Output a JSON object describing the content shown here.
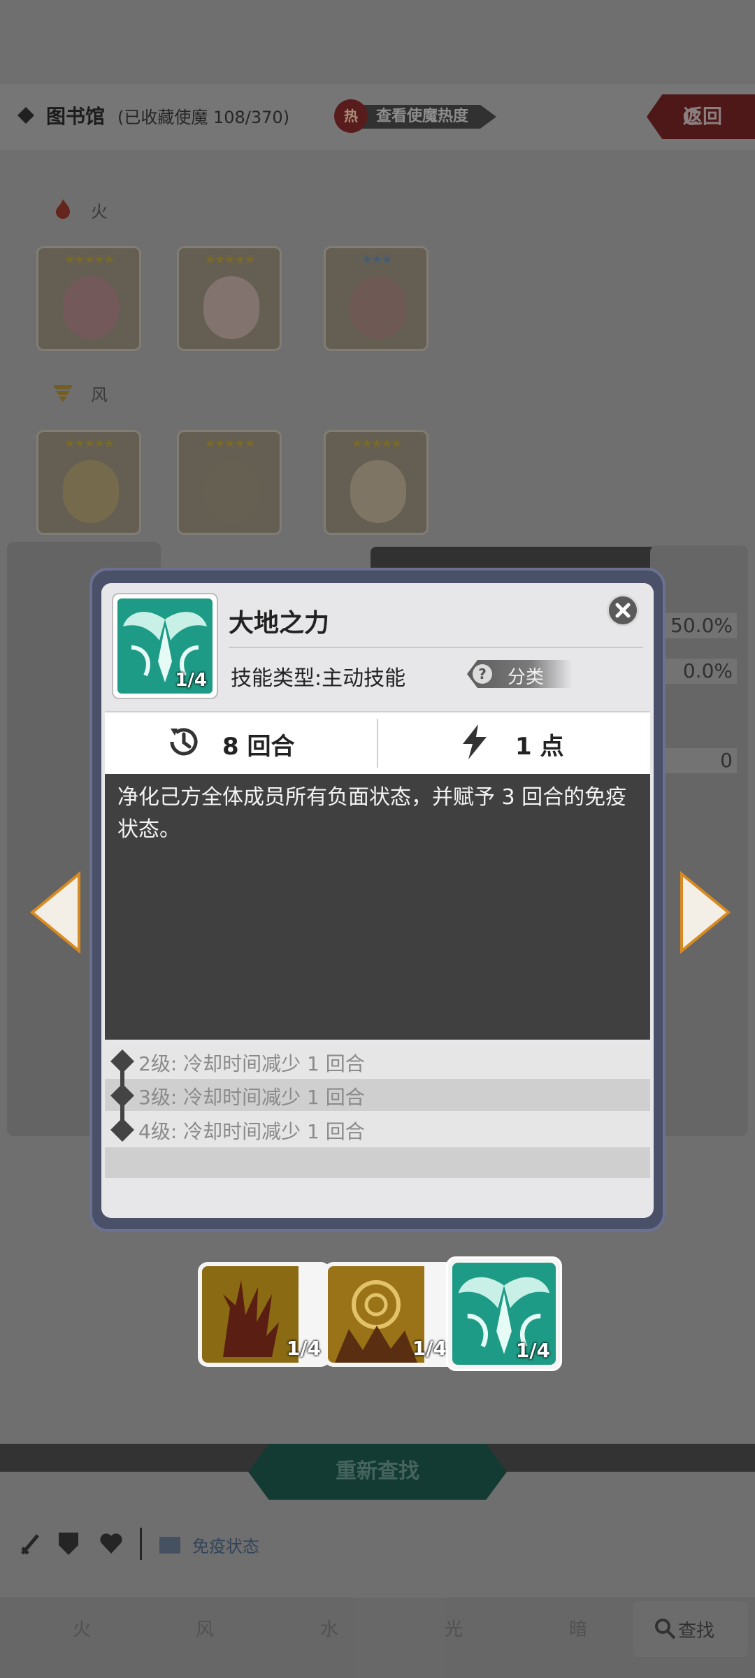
{
  "header": {
    "title": "图书馆",
    "collection_count": "(已收藏使魔 108/370)",
    "hot_badge_char": "热",
    "hot_badge_label": "查看使魔热度",
    "return_label": "返回"
  },
  "library": {
    "sections": [
      {
        "element": "火",
        "icon": "fire-icon"
      },
      {
        "element": "风",
        "icon": "wind-icon"
      }
    ]
  },
  "right_panel": {
    "values": [
      "50.0%",
      "0.0%",
      "0"
    ]
  },
  "modal": {
    "skill_name": "大地之力",
    "skill_level_badge": "1/4",
    "skill_type_label": "技能类型:",
    "skill_type_value": "主动技能",
    "category_label": "分类",
    "cooldown": "8 回合",
    "cost": "1 点",
    "description": "净化己方全体成员所有负面状态，并赋予 3 回合的免疫状态。",
    "upgrades": [
      "2级:  冷却时间减少 1 回合",
      "3级:  冷却时间减少 1 回合",
      "4级:  冷却时间减少 1 回合"
    ]
  },
  "skill_chips": [
    {
      "level": "1/4",
      "icon": "shadow-claw-skill-icon",
      "selected": false
    },
    {
      "level": "1/4",
      "icon": "spiral-sun-skill-icon",
      "selected": false
    },
    {
      "level": "1/4",
      "icon": "earth-power-skill-icon",
      "selected": true
    }
  ],
  "bottom": {
    "research_button": "重新查找",
    "filter_status": "免疫状态",
    "tabs": [
      "火",
      "风",
      "水",
      "光",
      "暗"
    ],
    "search_tab": "查找"
  },
  "colors": {
    "accent_teal": "#1e9b86",
    "modal_frame": "#4a5068",
    "description_bg": "#404040"
  }
}
